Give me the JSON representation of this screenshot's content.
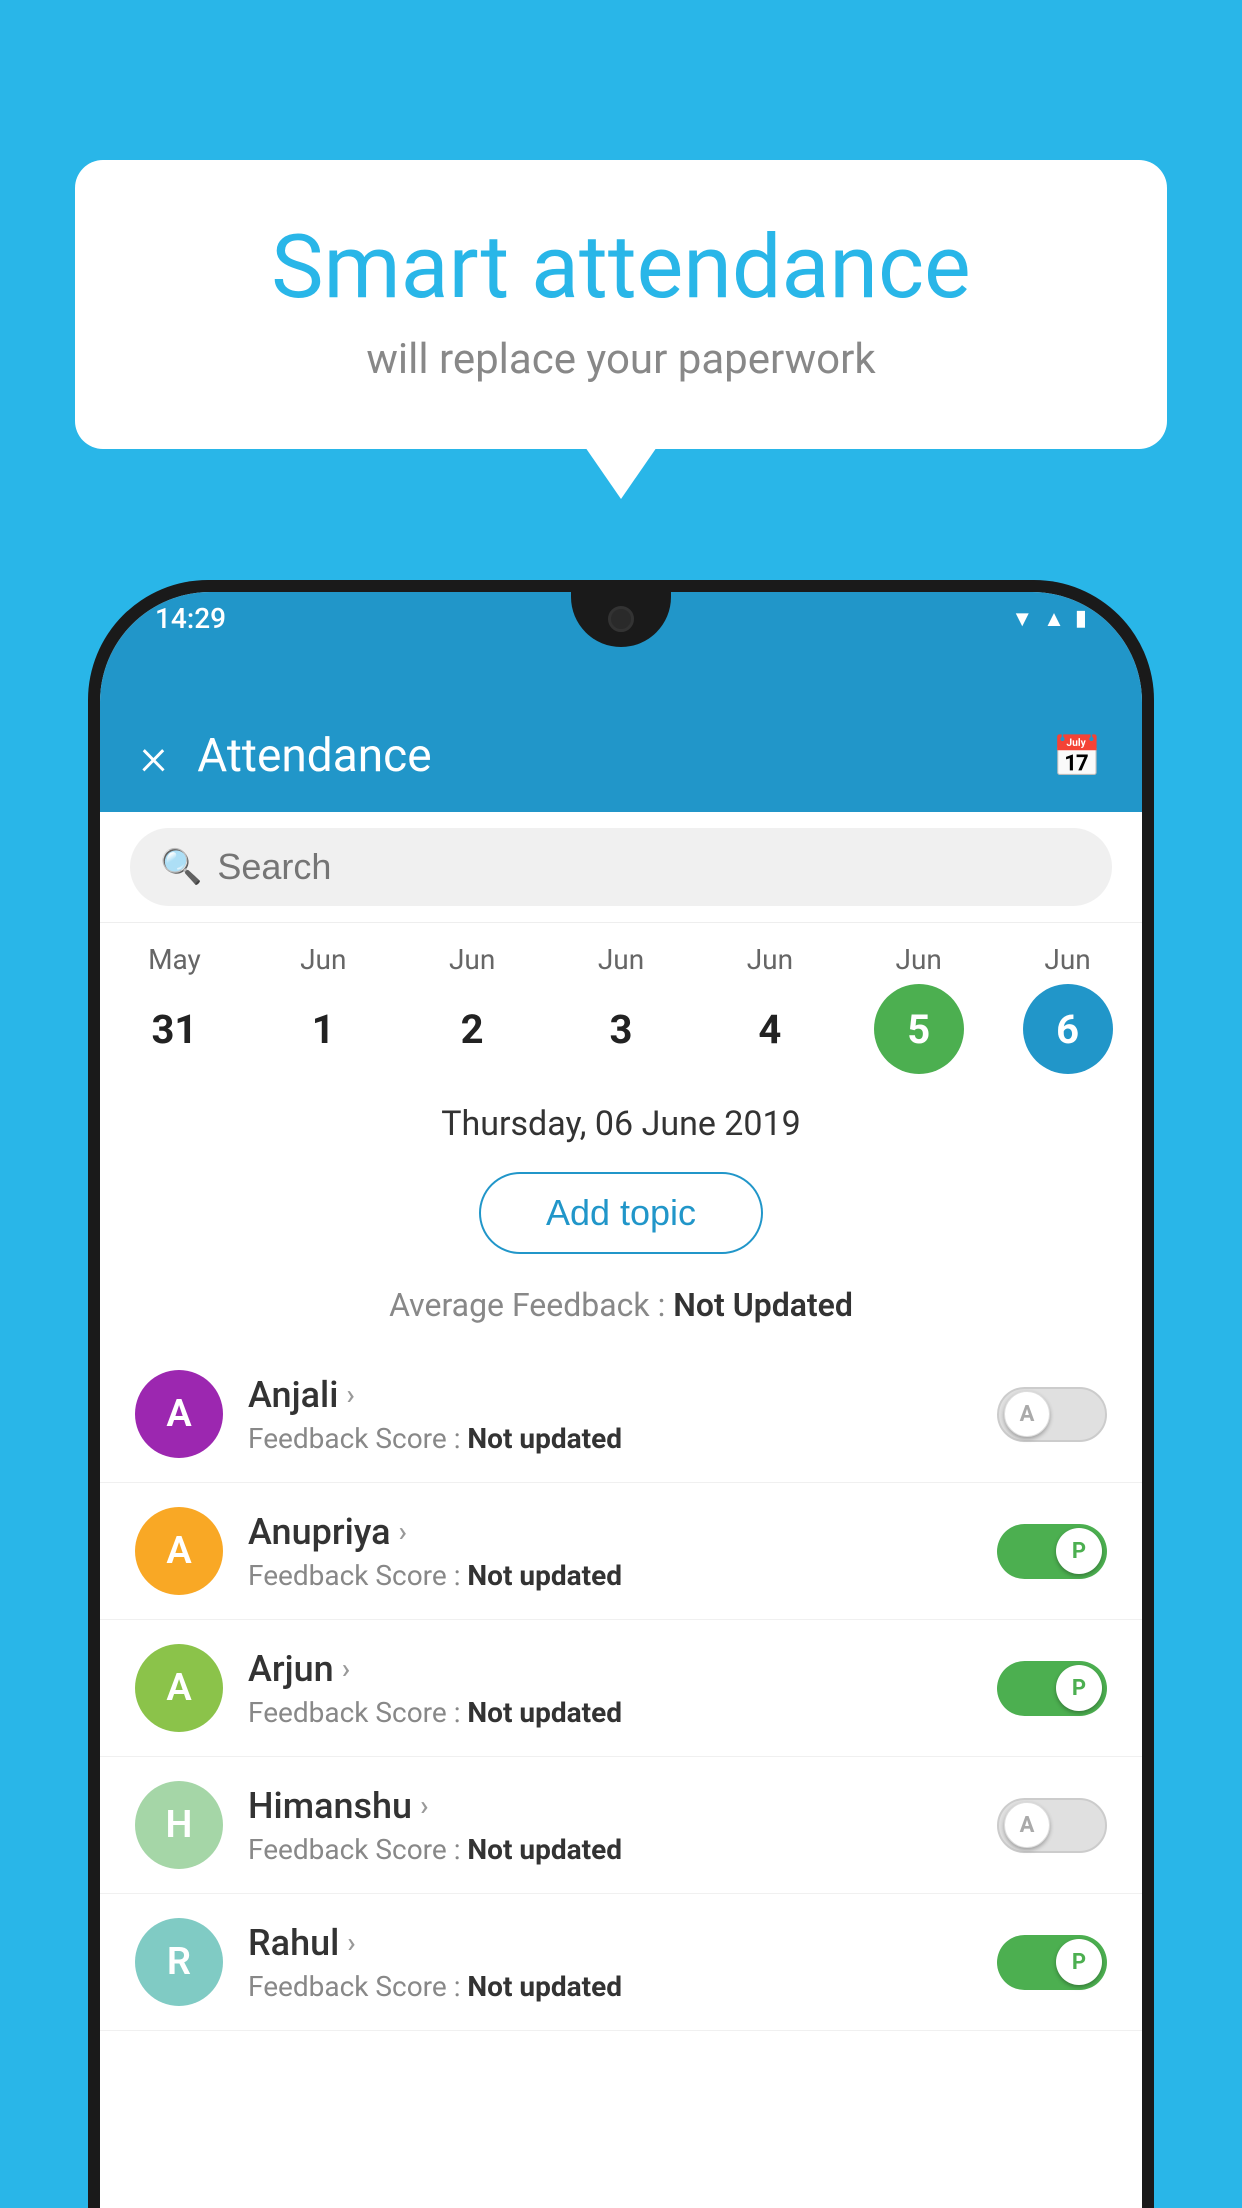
{
  "background_color": "#29b6e8",
  "speech_bubble": {
    "title": "Smart attendance",
    "subtitle": "will replace your paperwork"
  },
  "status_bar": {
    "time": "14:29",
    "icons": [
      "wifi",
      "signal",
      "battery"
    ]
  },
  "app_bar": {
    "title": "Attendance",
    "close_label": "×",
    "calendar_icon": "📅"
  },
  "search": {
    "placeholder": "Search"
  },
  "dates": [
    {
      "month": "May",
      "day": "31",
      "style": "normal"
    },
    {
      "month": "Jun",
      "day": "1",
      "style": "normal"
    },
    {
      "month": "Jun",
      "day": "2",
      "style": "normal"
    },
    {
      "month": "Jun",
      "day": "3",
      "style": "normal"
    },
    {
      "month": "Jun",
      "day": "4",
      "style": "normal"
    },
    {
      "month": "Jun",
      "day": "5",
      "style": "today"
    },
    {
      "month": "Jun",
      "day": "6",
      "style": "selected"
    }
  ],
  "selected_date_label": "Thursday, 06 June 2019",
  "add_topic_label": "Add topic",
  "average_feedback_label": "Average Feedback :",
  "average_feedback_value": "Not Updated",
  "students": [
    {
      "name": "Anjali",
      "avatar_letter": "A",
      "avatar_color": "#9c27b0",
      "feedback_label": "Feedback Score :",
      "feedback_value": "Not updated",
      "toggle_state": "off",
      "toggle_letter": "A"
    },
    {
      "name": "Anupriya",
      "avatar_letter": "A",
      "avatar_color": "#f9a825",
      "feedback_label": "Feedback Score :",
      "feedback_value": "Not updated",
      "toggle_state": "on",
      "toggle_letter": "P"
    },
    {
      "name": "Arjun",
      "avatar_letter": "A",
      "avatar_color": "#8bc34a",
      "feedback_label": "Feedback Score :",
      "feedback_value": "Not updated",
      "toggle_state": "on",
      "toggle_letter": "P"
    },
    {
      "name": "Himanshu",
      "avatar_letter": "H",
      "avatar_color": "#a5d6a7",
      "feedback_label": "Feedback Score :",
      "feedback_value": "Not updated",
      "toggle_state": "off",
      "toggle_letter": "A"
    },
    {
      "name": "Rahul",
      "avatar_letter": "R",
      "avatar_color": "#80cbc4",
      "feedback_label": "Feedback Score :",
      "feedback_value": "Not updated",
      "toggle_state": "on",
      "toggle_letter": "P"
    }
  ]
}
